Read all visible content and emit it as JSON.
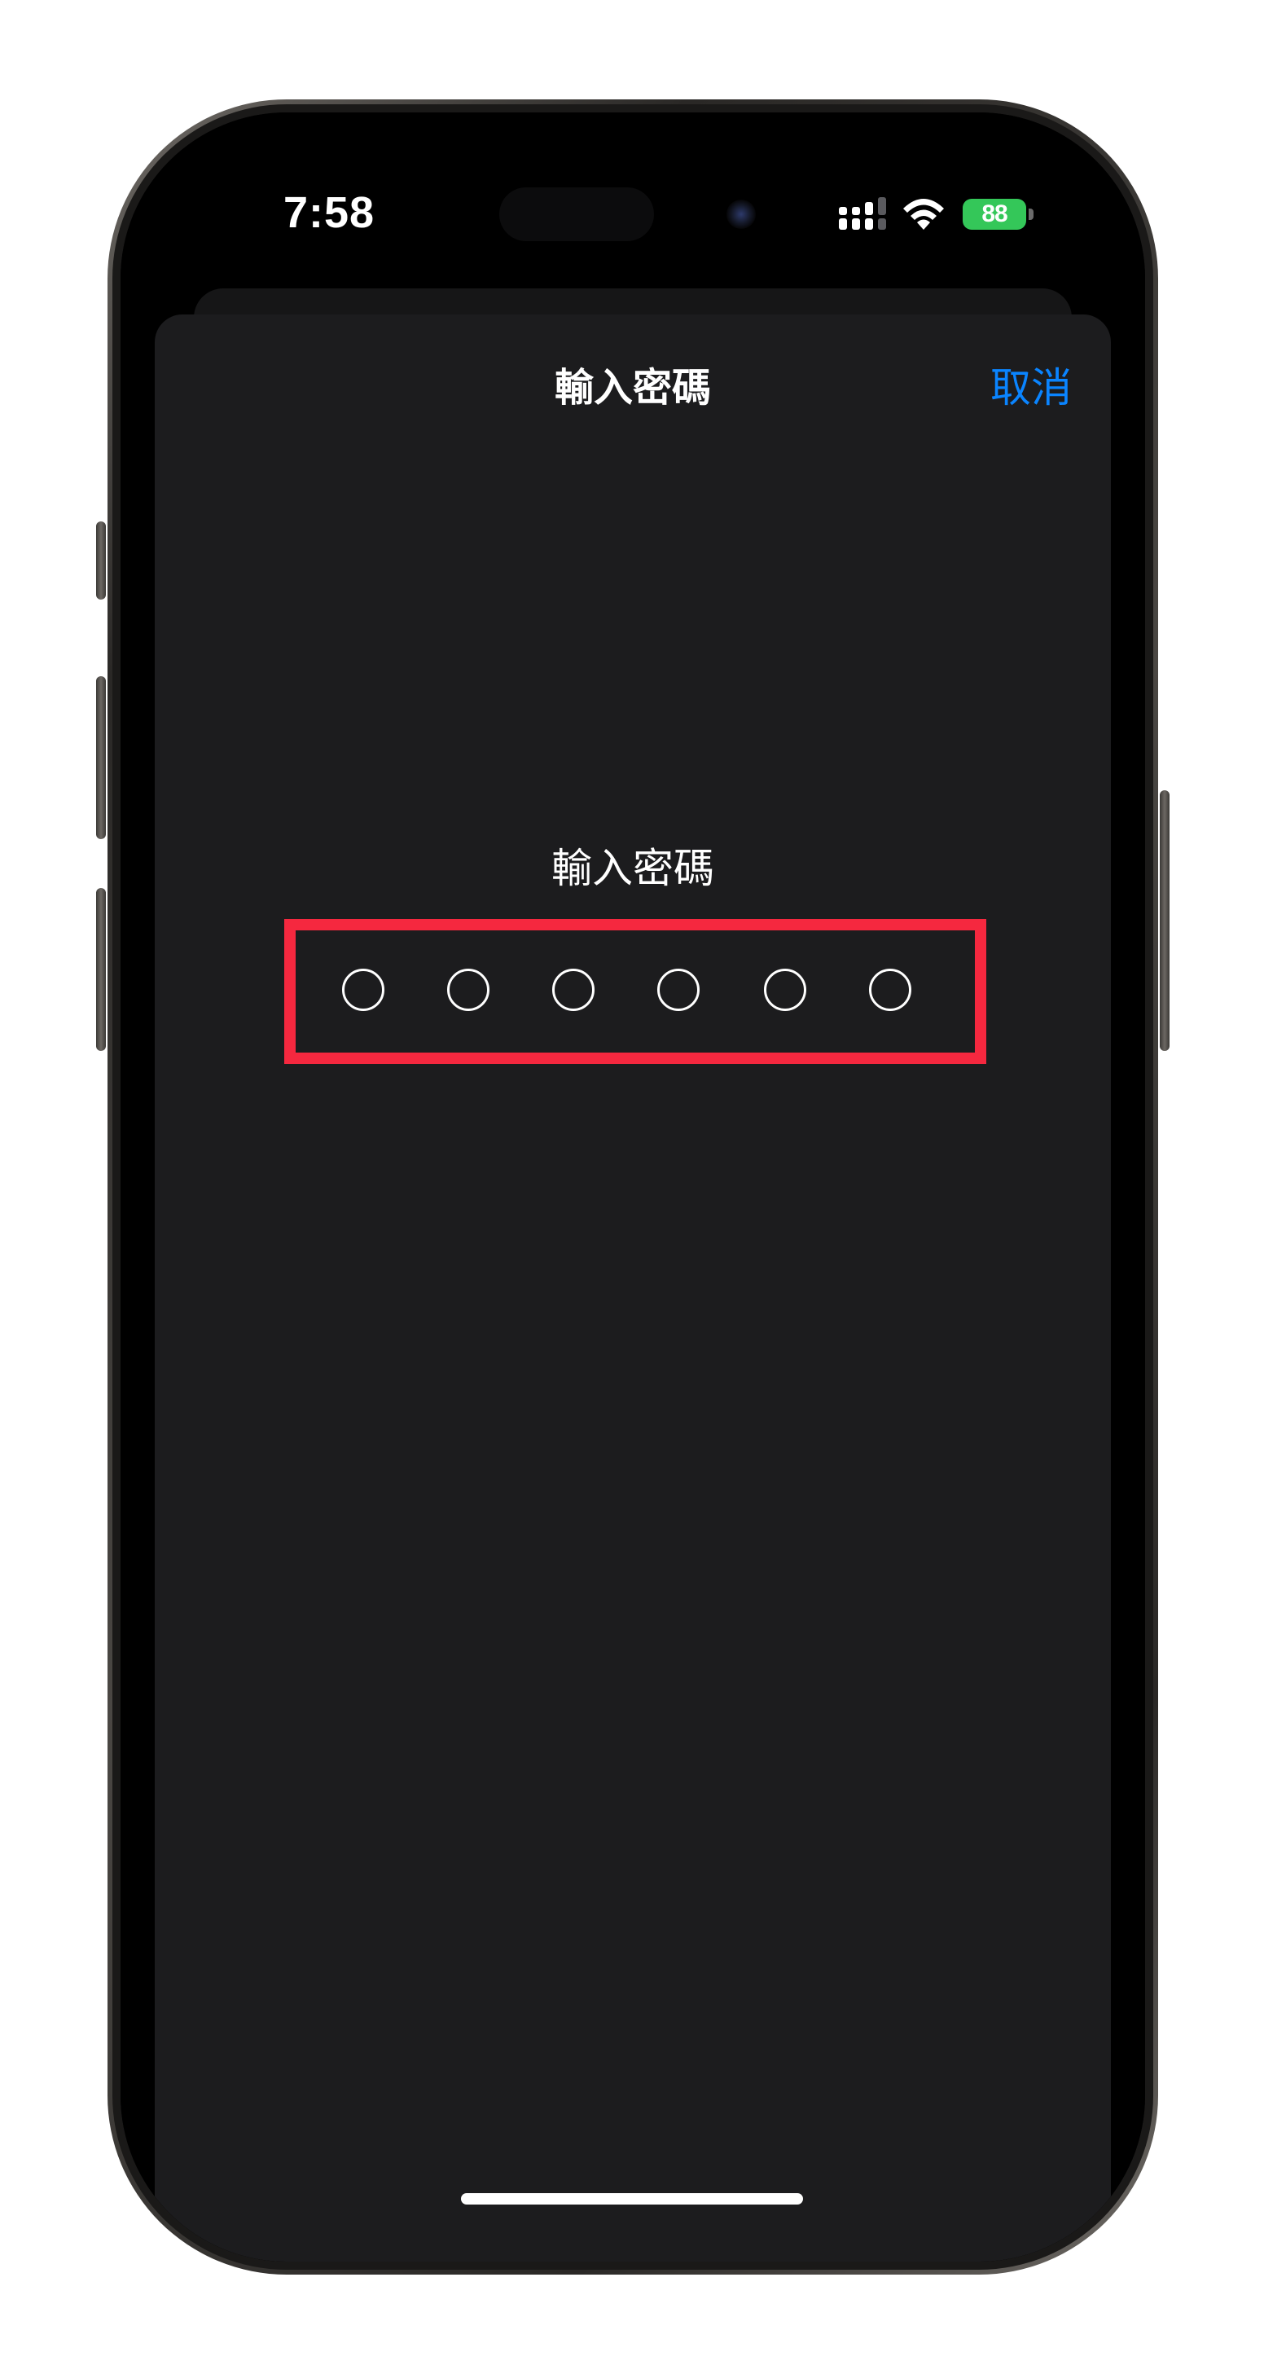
{
  "status_bar": {
    "time": "7:58",
    "battery_level": "88",
    "cellular": "signal-icon",
    "wifi": "wifi-icon"
  },
  "sheet": {
    "title": "輸入密碼",
    "cancel_label": "取消",
    "prompt": "輸入密碼",
    "passcode_length": 6,
    "digits_entered": 0
  },
  "colors": {
    "accent": "#0a84ff",
    "highlight": "#f5283f",
    "battery": "#34c759",
    "sheet_background": "#1c1c1e"
  }
}
